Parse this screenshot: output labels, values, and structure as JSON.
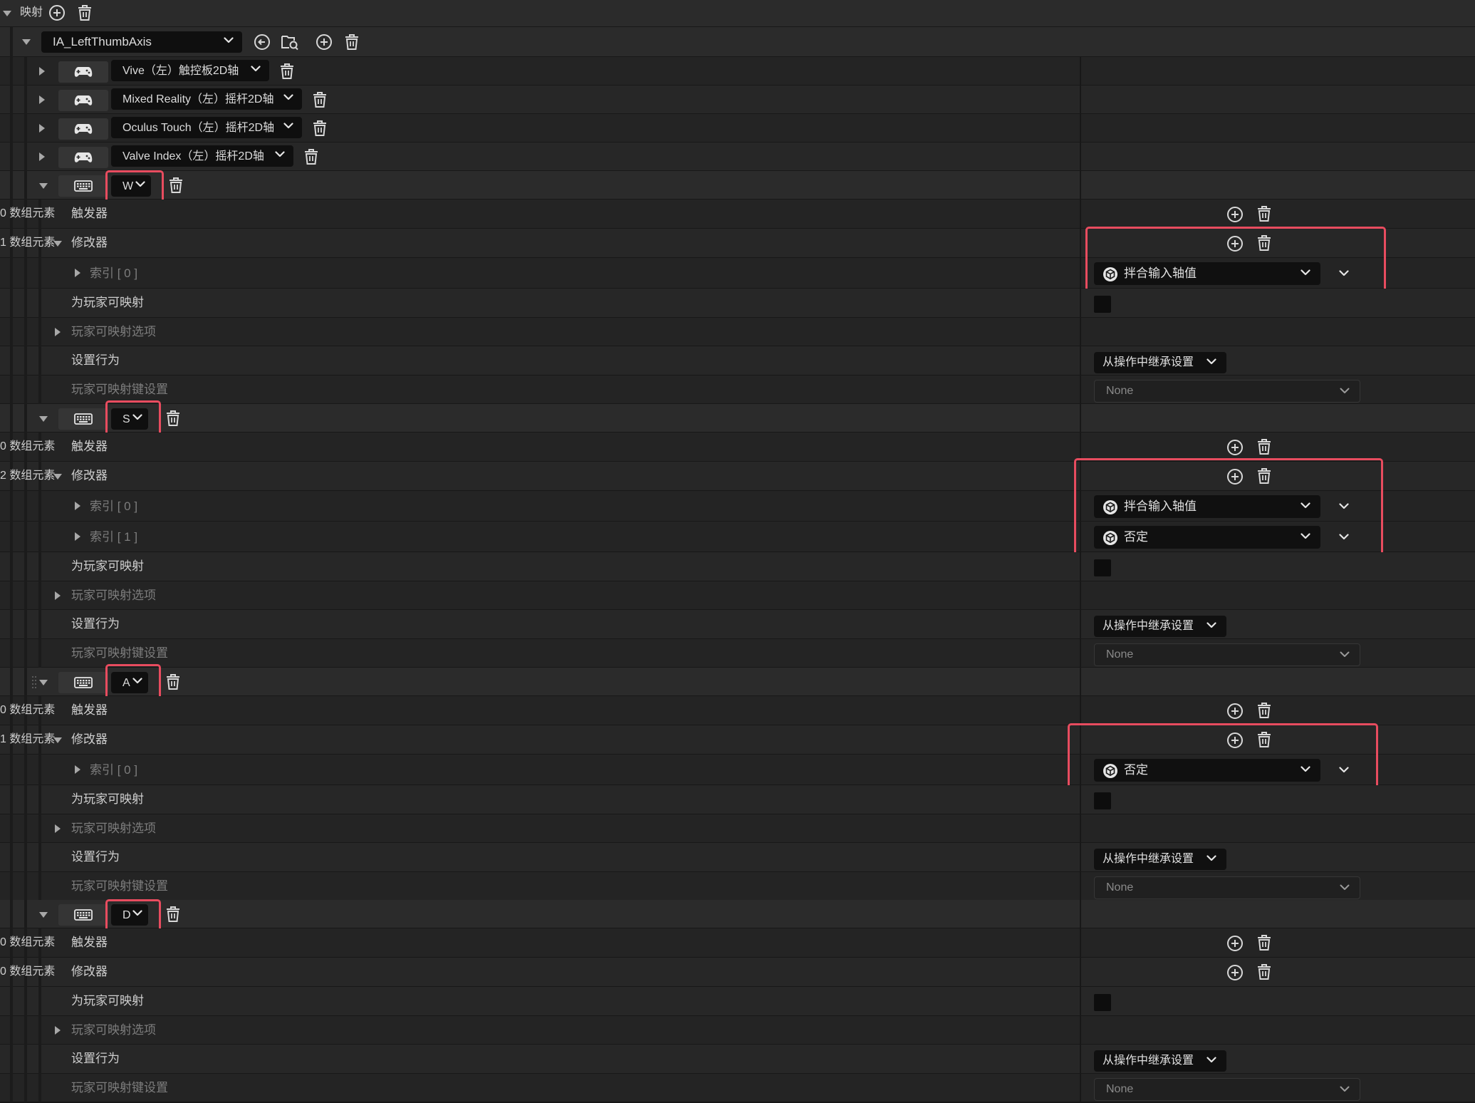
{
  "mappings": {
    "label": "映射",
    "action": {
      "name": "IA_LeftThumbAxis",
      "collapsed_bindings": [
        {
          "key": "Vive（左）触控板2D轴",
          "device": "gamepad-icon"
        },
        {
          "key": "Mixed Reality（左）摇杆2D轴",
          "device": "gamepad-icon"
        },
        {
          "key": "Oculus Touch（左）摇杆2D轴",
          "device": "gamepad-icon"
        },
        {
          "key": "Valve Index（左）摇杆2D轴",
          "device": "gamepad-icon"
        }
      ],
      "bindings": [
        {
          "key": "W",
          "device": "keyboard-icon",
          "triggers_count": "0 数组元素",
          "modifiers_count": "1 数组元素",
          "modifiers": [
            {
              "index": "索引 [ 0 ]",
              "value": "拌合输入轴值"
            }
          ],
          "behavior": "从操作中继承设置",
          "key_settings": "None"
        },
        {
          "key": "S",
          "device": "keyboard-icon",
          "triggers_count": "0 数组元素",
          "modifiers_count": "2 数组元素",
          "modifiers": [
            {
              "index": "索引 [ 0 ]",
              "value": "拌合输入轴值"
            },
            {
              "index": "索引 [ 1 ]",
              "value": "否定"
            }
          ],
          "behavior": "从操作中继承设置",
          "key_settings": "None"
        },
        {
          "key": "A",
          "device": "keyboard-icon",
          "triggers_count": "0 数组元素",
          "modifiers_count": "1 数组元素",
          "modifiers": [
            {
              "index": "索引 [ 0 ]",
              "value": "否定"
            }
          ],
          "behavior": "从操作中继承设置",
          "key_settings": "None"
        },
        {
          "key": "D",
          "device": "keyboard-icon",
          "triggers_count": "0 数组元素",
          "modifiers_count": "0 数组元素",
          "modifiers": [],
          "behavior": "从操作中继承设置",
          "key_settings": "None"
        }
      ]
    }
  },
  "labels": {
    "triggers": "触发器",
    "modifiers": "修改器",
    "player_mappable": "为玩家可映射",
    "player_mappable_options": "玩家可映射选项",
    "setting_behavior": "设置行为",
    "player_mappable_key_settings": "玩家可映射键设置"
  },
  "colors": {
    "highlight": "#e84c5f",
    "background": "#242424",
    "dropdown": "#0f0f0f"
  }
}
